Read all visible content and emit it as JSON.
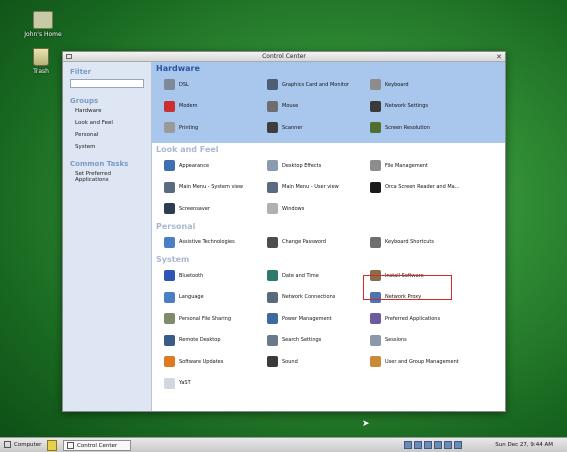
{
  "desktop": {
    "home_label": "John's Home",
    "trash_label": "Trash"
  },
  "window": {
    "title": "Control Center",
    "close_glyph": "✕"
  },
  "sidebar": {
    "filter_heading": "Filter",
    "groups_heading": "Groups",
    "groups": [
      "Hardware",
      "Look and Feel",
      "Personal",
      "System"
    ],
    "tasks_heading": "Common Tasks",
    "tasks": [
      "Set Preferred Applications"
    ]
  },
  "sections": {
    "hardware": {
      "title": "Hardware",
      "items": [
        {
          "label": "DSL",
          "icon": "dsl-icon",
          "color": "#7d8a99"
        },
        {
          "label": "Graphics Card and Monitor",
          "icon": "monitor-icon",
          "color": "#4d5d73"
        },
        {
          "label": "Keyboard",
          "icon": "keyboard-icon",
          "color": "#8c8c8c"
        },
        {
          "label": "Modem",
          "icon": "modem-icon",
          "color": "#c93030"
        },
        {
          "label": "Mouse",
          "icon": "mouse-icon",
          "color": "#6e6e6e"
        },
        {
          "label": "Network Settings",
          "icon": "network-icon",
          "color": "#3a3a3a"
        },
        {
          "label": "Printing",
          "icon": "printer-icon",
          "color": "#9a9a9a"
        },
        {
          "label": "Scanner",
          "icon": "scanner-icon",
          "color": "#3d3d3d"
        },
        {
          "label": "Screen Resolution",
          "icon": "screen-icon",
          "color": "#4e6f2e"
        }
      ]
    },
    "look": {
      "title": "Look and Feel",
      "items": [
        {
          "label": "Appearance",
          "icon": "appearance-icon",
          "color": "#3f6fb0"
        },
        {
          "label": "Desktop Effects",
          "icon": "desktop-effects-icon",
          "color": "#8a9bb0"
        },
        {
          "label": "File Management",
          "icon": "file-management-icon",
          "color": "#8d8d8d"
        },
        {
          "label": "Main Menu - System view",
          "icon": "menu-system-icon",
          "color": "#5a6b7f"
        },
        {
          "label": "Main Menu - User view",
          "icon": "menu-user-icon",
          "color": "#5a6b7f"
        },
        {
          "label": "Orca Screen Reader and Ma...",
          "icon": "orca-icon",
          "color": "#1a1a1a"
        },
        {
          "label": "Screensaver",
          "icon": "screensaver-icon",
          "color": "#2e3c52"
        },
        {
          "label": "Windows",
          "icon": "windows-icon",
          "color": "#b0b0b0"
        }
      ]
    },
    "personal": {
      "title": "Personal",
      "items": [
        {
          "label": "Assistive Technologies",
          "icon": "accessibility-icon",
          "color": "#4a7fc4"
        },
        {
          "label": "Change Password",
          "icon": "key-icon",
          "color": "#4d4d4d"
        },
        {
          "label": "Keyboard Shortcuts",
          "icon": "keyboard-shortcuts-icon",
          "color": "#6f6f6f"
        }
      ]
    },
    "system": {
      "title": "System",
      "items": [
        {
          "label": "Bluetooth",
          "icon": "bluetooth-icon",
          "color": "#2c55b5"
        },
        {
          "label": "Date and Time",
          "icon": "clock-icon",
          "color": "#2f7a6a"
        },
        {
          "label": "Install Software",
          "icon": "install-software-icon",
          "color": "#8a6b4a"
        },
        {
          "label": "Language",
          "icon": "language-icon",
          "color": "#4a7fc4"
        },
        {
          "label": "Network Connections",
          "icon": "network-connections-icon",
          "color": "#5b6a7a"
        },
        {
          "label": "Network Proxy",
          "icon": "proxy-icon",
          "color": "#4d74b0"
        },
        {
          "label": "Personal File Sharing",
          "icon": "file-sharing-icon",
          "color": "#7d8c6a"
        },
        {
          "label": "Power Management",
          "icon": "power-icon",
          "color": "#3d6a9e"
        },
        {
          "label": "Preferred Applications",
          "icon": "preferred-apps-icon",
          "color": "#6a5aa0"
        },
        {
          "label": "Remote Desktop",
          "icon": "remote-desktop-icon",
          "color": "#3a5a8a"
        },
        {
          "label": "Search Settings",
          "icon": "search-icon",
          "color": "#6a7a8a"
        },
        {
          "label": "Sessions",
          "icon": "sessions-icon",
          "color": "#8a9aaa"
        },
        {
          "label": "Software Updates",
          "icon": "software-updates-icon",
          "color": "#e07a20"
        },
        {
          "label": "Sound",
          "icon": "sound-icon",
          "color": "#3a3a3a"
        },
        {
          "label": "User and Group Management",
          "icon": "users-icon",
          "color": "#c98a3a"
        },
        {
          "label": "YaST",
          "icon": "yast-icon",
          "color": "#cfd8e0"
        }
      ]
    }
  },
  "taskbar": {
    "computer_label": "Computer",
    "task_label": "Control Center",
    "clock": "Sun Dec 27,  9:44 AM"
  }
}
